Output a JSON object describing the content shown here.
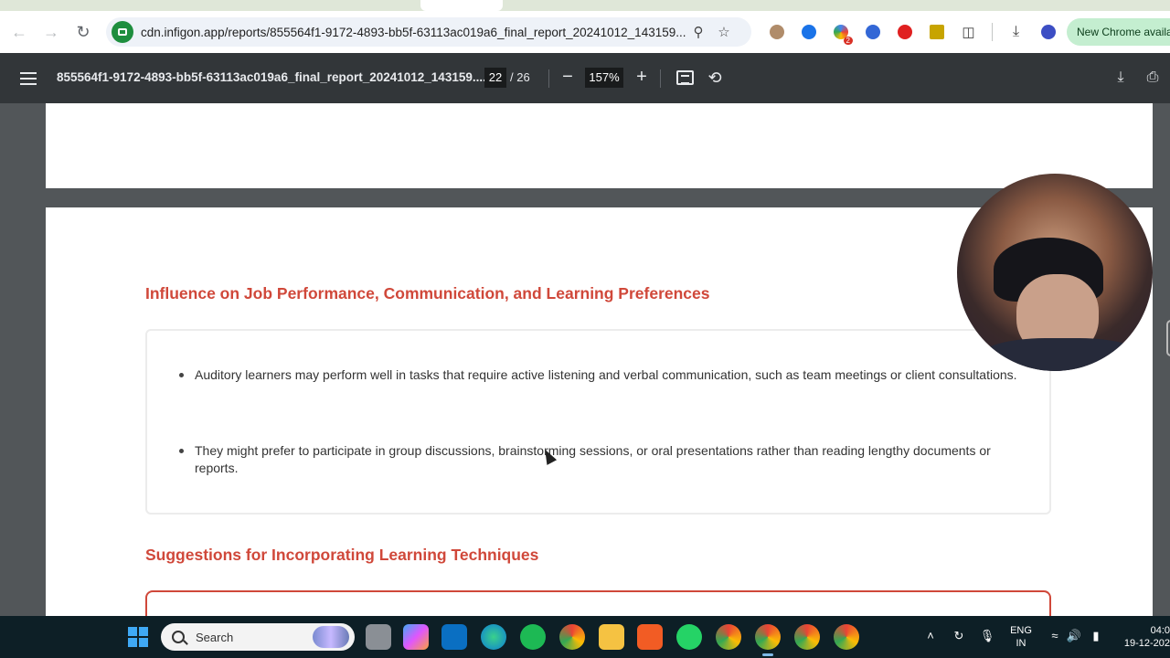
{
  "browser": {
    "url": "cdn.infigon.app/reports/855564f1-9172-4893-bb5f-63113ac019a6_final_report_20241012_143159...",
    "update_label": "New Chrome availab",
    "extension_badge": "2"
  },
  "pdf_toolbar": {
    "title": "855564f1-9172-4893-bb5f-63113ac019a6_final_report_20241012_143159....",
    "current_page": "22",
    "total_pages": "/ 26",
    "zoom": "157%",
    "zoom_minus": "−",
    "zoom_plus": "+"
  },
  "document": {
    "section1": {
      "heading": "Influence on Job Performance, Communication, and Learning Preferences",
      "bullets": [
        "Auditory learners may perform well in tasks that require active listening and verbal communication, such as team meetings or client consultations.",
        "They might prefer to participate in group discussions, brainstorming sessions, or oral presentations rather than reading lengthy documents or reports."
      ]
    },
    "section2": {
      "heading": "Suggestions for Incorporating Learning Techniques"
    }
  },
  "taskbar": {
    "search_placeholder": "Search",
    "language_top": "ENG",
    "language_bottom": "IN",
    "time": "04:0",
    "date": "19-12-202"
  },
  "colors": {
    "heading_accent": "#d0483a",
    "pdf_toolbar_bg": "#323639",
    "viewer_bg": "#525659",
    "taskbar_bg": "#0d1f26"
  }
}
